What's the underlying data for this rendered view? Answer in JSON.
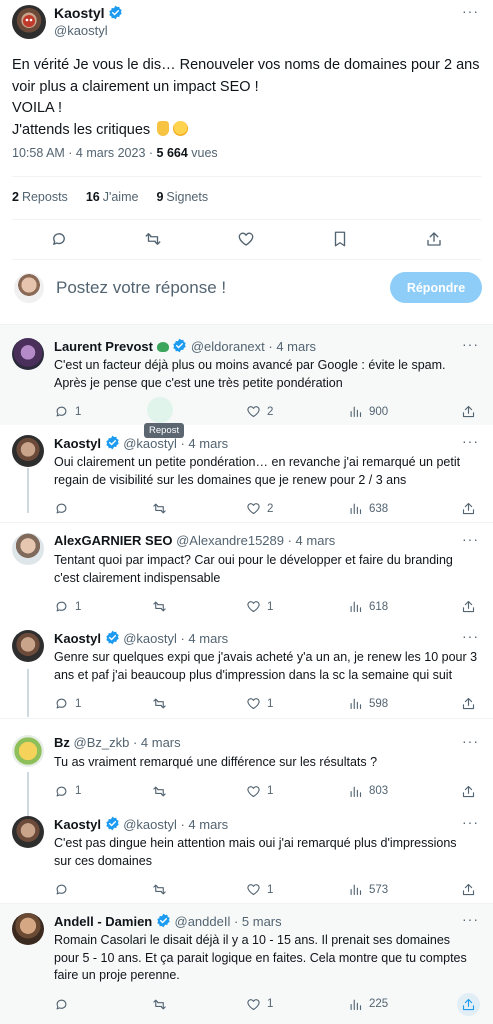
{
  "main_tweet": {
    "author": "Kaostyl",
    "handle": "@kaostyl",
    "text_lines": [
      "En vérité Je vous le dis… Renouveler vos noms de domaines pour 2 ans",
      "voir plus a clairement un impact SEO !",
      "VOILA !",
      "J'attends les critiques"
    ],
    "time": "10:58 AM · 4 mars 2023 · ",
    "views_count": "5 664",
    "views_label": " vues",
    "reposts_count": "2",
    "reposts_label": "Reposts",
    "likes_count": "16",
    "likes_label": "J'aime",
    "bookmarks_count": "9",
    "bookmarks_label": "Signets",
    "more": "···"
  },
  "compose": {
    "placeholder": "Postez votre réponse !",
    "button_label": "Répondre"
  },
  "tooltip": "Repost",
  "replies": [
    {
      "name": "Laurent Prevost",
      "handle": "@eldoranext · 4 mars",
      "lines": [
        "C'est un facteur déjà plus ou moins avancé par Google : évite le spam.",
        "Après je pense que c'est une très petite pondération"
      ],
      "replies": "1",
      "reposts": "",
      "likes": "2",
      "views": "900"
    },
    {
      "name": "Kaostyl",
      "handle": "@kaostyl · 4 mars",
      "lines": [
        "Oui clairement un petite pondération… en revanche j'ai remarqué un petit",
        "regain de visibilité sur les domaines que je renew pour 2 / 3 ans"
      ],
      "replies": "",
      "reposts": "",
      "likes": "2",
      "views": "638"
    },
    {
      "name": "AlexGARNIER SEO",
      "handle": "@Alexandre15289 · 4 mars",
      "lines": [
        "Tentant quoi par impact? Car oui pour le développer et faire du branding",
        "c'est clairement indispensable"
      ],
      "replies": "1",
      "reposts": "",
      "likes": "1",
      "views": "618"
    },
    {
      "name": "Kaostyl",
      "handle": "@kaostyl · 4 mars",
      "lines": [
        "Genre sur quelques expi que j'avais acheté y'a un an, je renew les 10 pour 3",
        "ans et paf j'ai beaucoup plus d'impression dans la sc la semaine qui suit"
      ],
      "replies": "1",
      "reposts": "",
      "likes": "1",
      "views": "598"
    },
    {
      "name": "Bz",
      "handle": "@Bz_zkb · 4 mars",
      "lines": [
        "Tu as vraiment remarqué une différence sur les résultats ?"
      ],
      "replies": "1",
      "reposts": "",
      "likes": "1",
      "views": "803"
    },
    {
      "name": "Kaostyl",
      "handle": "@kaostyl · 4 mars",
      "lines": [
        "C'est pas dingue hein attention mais oui j'ai remarqué plus d'impressions",
        "sur ces domaines"
      ],
      "replies": "",
      "reposts": "",
      "likes": "1",
      "views": "573"
    },
    {
      "name": "Andell - Damien",
      "handle": "@anddeIl · 5 mars",
      "lines": [
        "Romain Casolari le disait déjà il y a 10 - 15 ans. Il prenait ses domaines",
        "pour 5 - 10 ans. Et ça parait logique en faites. Cela montre que tu comptes",
        "faire un proje perenne."
      ],
      "replies": "",
      "reposts": "",
      "likes": "1",
      "views": "225"
    }
  ],
  "colors": {
    "accent": "#1d9bf0",
    "muted": "#536471",
    "repost_green": "#00ba7c",
    "reply_button": "#8ecdf8"
  }
}
